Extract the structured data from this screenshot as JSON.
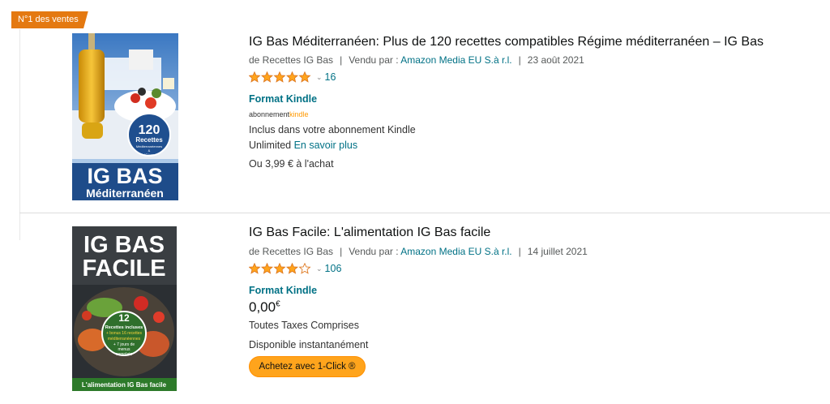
{
  "badge": "N°1 des ventes",
  "items": [
    {
      "cover": {
        "line1": "IG BAS",
        "line2": "Méditerranéen",
        "count": "120",
        "sub1": "Recettes",
        "sub2": "Méditerranéennes",
        "sub3": "&",
        "sub4": "IG bas"
      },
      "title": "IG Bas Méditerranéen: Plus de 120 recettes compatibles Régime méditerranéen – IG Bas",
      "author": "de Recettes IG Bas",
      "sold_by_label": "Vendu par :",
      "seller": "Amazon Media EU S.à r.l.",
      "date": "23 août 2021",
      "rating": 5,
      "rating_count": "16",
      "format": "Format Kindle",
      "abo_prefix": "abonnement",
      "abo_kindle": "kindle",
      "included_line1": "Inclus dans votre abonnement Kindle",
      "included_line2": "Unlimited",
      "learn_more": "En savoir plus",
      "buy_price": "Ou 3,99 € à l'achat"
    },
    {
      "cover": {
        "line1": "IG BAS",
        "line2": "FACILE",
        "count": "12",
        "sub1": "Recettes incluses",
        "sub2": "+ bonus 16 recettes",
        "sub3": "méditerranéennes",
        "sub4": "+ 7 jours de",
        "sub5": "menus",
        "sub6": "complets",
        "bottom": "L'alimentation IG Bas facile"
      },
      "title": "IG Bas Facile: L'alimentation IG Bas facile",
      "author": "de Recettes IG Bas",
      "sold_by_label": "Vendu par :",
      "seller": "Amazon Media EU S.à r.l.",
      "date": "14 juillet 2021",
      "rating": 4,
      "rating_count": "106",
      "format": "Format Kindle",
      "price": "0,00",
      "currency": "€",
      "taxes": "Toutes Taxes Comprises",
      "availability": "Disponible instantanément",
      "buy_button": "Achetez avec 1-Click ®"
    }
  ],
  "colors": {
    "accent": "#e47911",
    "link": "#007185",
    "star": "#ffa41c",
    "button": "#ffa41c"
  }
}
